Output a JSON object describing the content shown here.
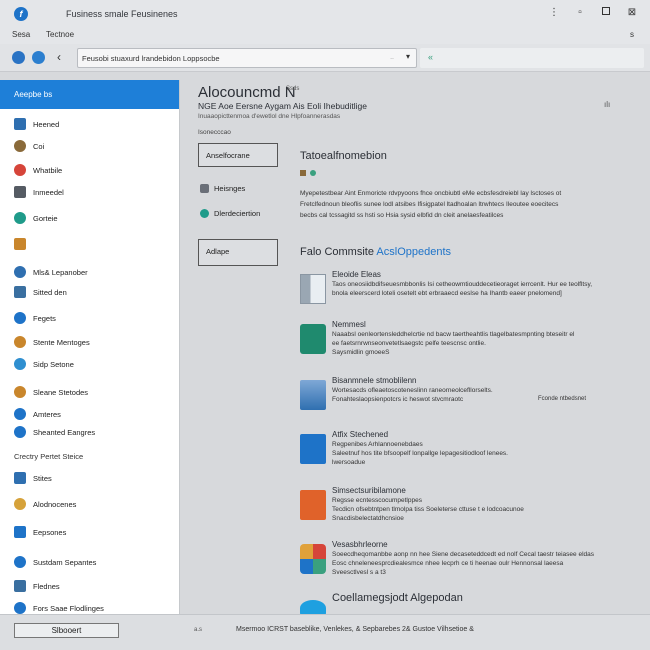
{
  "window": {
    "title": "Fusiness smale Feusinenes",
    "logo_glyph": "f"
  },
  "menu": {
    "items": [
      "Sesa",
      "Tectnoe"
    ],
    "right": "s"
  },
  "toolbar": {
    "address": "Feusobi stuaxurd lrandebidon Loppsocbe",
    "address_indicator": "..",
    "right_icon": "«"
  },
  "sidebar": {
    "header": "Aeepbe bs",
    "items": [
      {
        "label": "Heened",
        "color": "#2f6fb0",
        "shape": "sq"
      },
      {
        "label": "Coi",
        "color": "#8a6a3a",
        "shape": "round"
      },
      {
        "label": "Whatbile",
        "color": "#d6453a",
        "shape": "round"
      },
      {
        "label": "Inmeedel",
        "color": "#555b63",
        "shape": "sq"
      },
      {
        "label": "Gorteie",
        "color": "#1f9b8a",
        "shape": "round"
      },
      {
        "label": "",
        "color": "#c9862c",
        "shape": "sq"
      },
      {
        "label": "Mls& Lepanober",
        "color": "#2f6fb0",
        "shape": "round"
      },
      {
        "label": "Sitted den",
        "color": "#3a6fa0",
        "shape": "sq"
      },
      {
        "label": "Fegets",
        "color": "#1e73c8",
        "shape": "round"
      },
      {
        "label": "Stente Mentoges",
        "color": "#c9862c",
        "shape": "round"
      },
      {
        "label": "Sidp Setone",
        "color": "#2f8fd0",
        "shape": "round"
      },
      {
        "label": "Sleane Stetodes",
        "color": "#c9862c",
        "shape": "round"
      },
      {
        "label": "Amteres",
        "color": "#1e73c8",
        "shape": "round"
      },
      {
        "label": "Sheanted Eangres",
        "color": "#1e73c8",
        "shape": "round"
      }
    ],
    "section": "Crectry Pertet Steice",
    "items2": [
      {
        "label": "Stites",
        "color": "#2f6fb0",
        "shape": "sq"
      },
      {
        "label": "Alodnocenes",
        "color": "#d6a23a",
        "shape": "round"
      },
      {
        "label": "Eepsones",
        "color": "#1e73c8",
        "shape": "sq"
      },
      {
        "label": "Sustdam Sepantes",
        "color": "#1e73c8",
        "shape": "round"
      },
      {
        "label": "Flednes",
        "color": "#3a6fa0",
        "shape": "sq"
      },
      {
        "label": "Fors Saae Flodlinges",
        "color": "#1e73c8",
        "shape": "round"
      }
    ]
  },
  "main": {
    "title": "Alocouncmd N",
    "badge": "Ssds",
    "subtitle": "NGE Aoe Eersne Aygam Ais Eoli Ihebuditlige",
    "desc": "Inuaaopicttenmoa d'ewetlol dne Hlpfoannerasdas",
    "corner": "ılı",
    "label": "Isonecccao"
  },
  "left_nav": {
    "button1": "Anselfocrane",
    "link1": "Heisnges",
    "link2": "Dlerdeciertion",
    "button2": "Adlape"
  },
  "section1": {
    "title": "Tatoealfnomebion",
    "para": [
      "Myepetestbear Aint Enmoricte rdvpyoons fhce oncbiubtl eMe ecbsfesdreiebl lay lsctoses ot",
      "Fretclfednoun bleoflis sunee lodl atsibes Ifisigpatel ltadhoalan ltrwhtecs Ileoutee eoecitecs",
      "becbs cal tcssagitd ss hsti so Hsia sysid elbfid dn cleit anelaesfeatilces"
    ]
  },
  "section2": {
    "title_prefix": "Falo Commsite ",
    "title_accent": "AcslOppedents"
  },
  "items": [
    {
      "title": "Eleoide Eleas",
      "icon": "book",
      "lines": [
        "Taos oneosiidbdifseuesmbbonlis Isi cetheowmtiouddecetieoraget ierrcenlt. Hur ee teolfltsy,",
        "bnola eleerscerd loteli osetelt ebt erbraaecd eeslse ha Ihantb eaeer pnelomend]"
      ]
    },
    {
      "title": "Nemmesl",
      "icon": "green",
      "lines": [
        "Naaabsl oenleortensleddhelcrtie nd bacw taertheahtlis tlagelbatesmpnting bteseitr el",
        "ee faetsrnrwnseonvetetlsaegstc pelfe teescnsc ontlie.",
        "Saysmidlin gmoeeS"
      ]
    },
    {
      "title": "Bisanmnele stmoblilenn",
      "icon": "pic",
      "lines": [
        "Wortesacds ofleaetoscoteneslinn raneorneolcefllorselts.",
        "Fonahteslaopsienpotcrs ic heswot stvcmraotc"
      ],
      "extra": "Fconde ntbedsnet"
    },
    {
      "title": "Atfix Stechened",
      "icon": "blue",
      "lines": [
        "Regpenibes Arhlannoenebdaes",
        "Saleetnuf hos tite bfsoopelf lonpallge lepagesitiodloof lenees.",
        "lwersoadue"
      ]
    },
    {
      "title": "Simsectsuribilamone",
      "icon": "orange",
      "lines": [
        "Regsse ecntesscocumpetlppes",
        "Tecdicn ofsebtntpen tlmolpa tiss Soeleterse cttuse t e lodcoacunoe",
        "Snacdisbelectatdhcnsioe"
      ]
    },
    {
      "title": "Vesasbhrleorne",
      "icon": "multi",
      "lines": [
        "Soeecdheqomanbbe aonp nn hee Siene decaseteddcedt ed nolf Cecal taestr teiasee eldas",
        "Eosc chneleneesprcdiealesmce nhee Iecprh ce ti heenae oulr Hennonsal laeesa",
        "Sveesctlvesl s a t3"
      ]
    },
    {
      "title": "Coellamegsjodt Algepodan",
      "icon": "cyan",
      "lines": []
    }
  ],
  "status": {
    "button": "Slbooert",
    "small": "a.s",
    "text": "Msermoo ICRST baseblike, Venlekes, & Sepbarebes 2& Gustoe Vilhsetioe &"
  }
}
